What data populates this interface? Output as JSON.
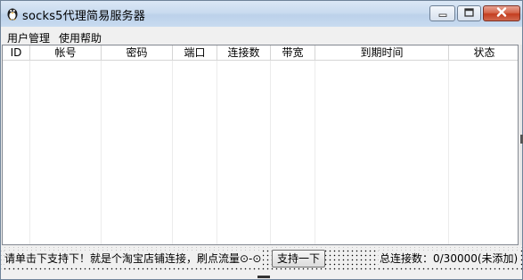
{
  "window": {
    "title": "socks5代理简易服务器",
    "app_icon": "penguin-icon",
    "controls": {
      "minimize": "minimize-icon",
      "maximize": "maximize-icon",
      "close": "close-icon"
    }
  },
  "menu": {
    "items": [
      {
        "label": "用户管理"
      },
      {
        "label": "使用帮助"
      }
    ]
  },
  "table": {
    "columns": [
      {
        "label": "ID"
      },
      {
        "label": "帐号"
      },
      {
        "label": "密码"
      },
      {
        "label": "端口"
      },
      {
        "label": "连接数"
      },
      {
        "label": "带宽"
      },
      {
        "label": "到期时间"
      },
      {
        "label": "状态"
      }
    ],
    "rows": []
  },
  "status": {
    "message": "请单击下支持下！就是个淘宝店铺连接，刷点流量⊙-⊙",
    "support_button": "支持一下",
    "connections": "总连接数：0/30000(未添加)"
  },
  "colors": {
    "close_button": "#c43d20",
    "title_bar": "#c9dbef"
  }
}
